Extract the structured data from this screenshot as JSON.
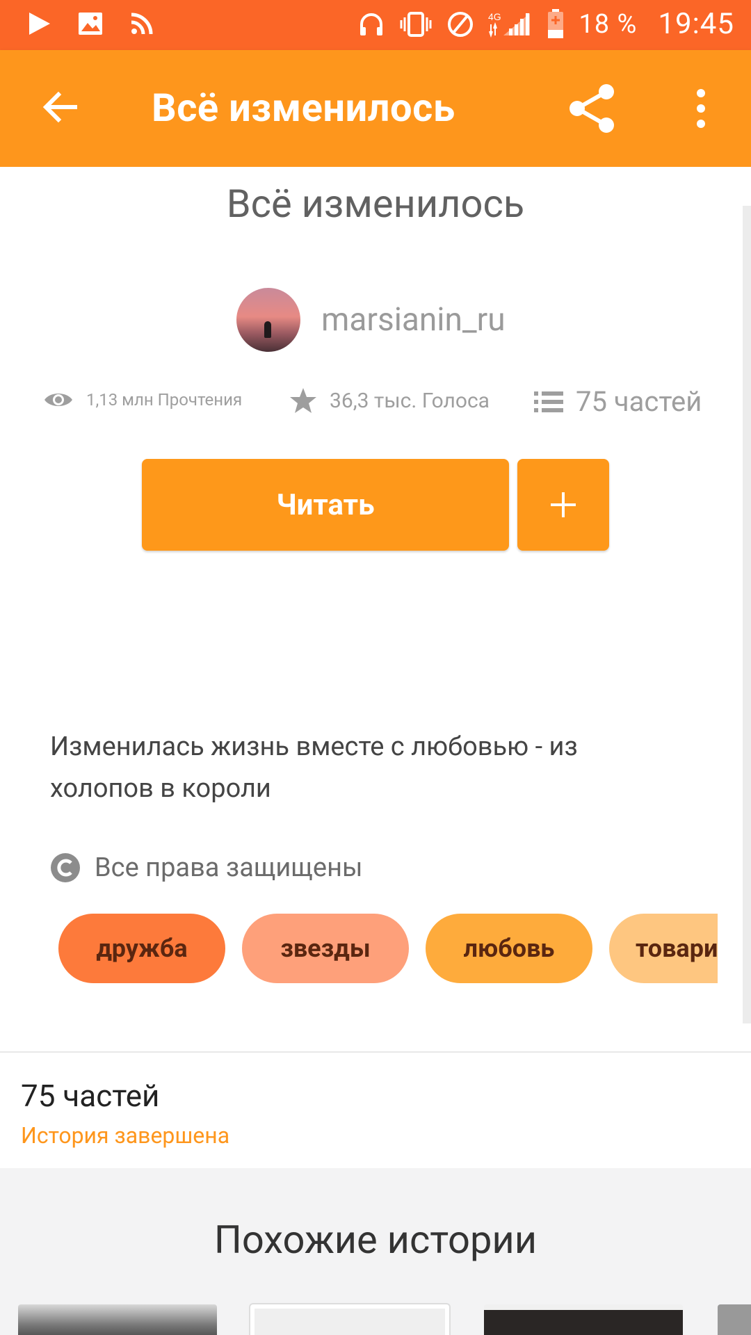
{
  "status_bar": {
    "battery": "18 %",
    "time": "19:45",
    "network": "4G"
  },
  "app_bar": {
    "title": "Всё изменилось"
  },
  "story": {
    "title": "Всё изменилось",
    "author": "marsianin_ru",
    "reads": "1,13 млн Прочтения",
    "votes": "36,3 тыс. Голоса",
    "parts": "75 частей",
    "read_button": "Читать",
    "add_button": "+",
    "description": "Изменилась жизнь вместе с любовью - из холопов в короли",
    "rights": "Все права защищены",
    "tags": [
      "дружба",
      "звезды",
      "любовь",
      "товари"
    ]
  },
  "parts_section": {
    "count": "75 частей",
    "status": "История завершена"
  },
  "similar": {
    "title": "Похожие истории"
  },
  "colors": {
    "status_bar": "#fb6627",
    "app_bar": "#fe961c",
    "accent": "#fe981a"
  }
}
